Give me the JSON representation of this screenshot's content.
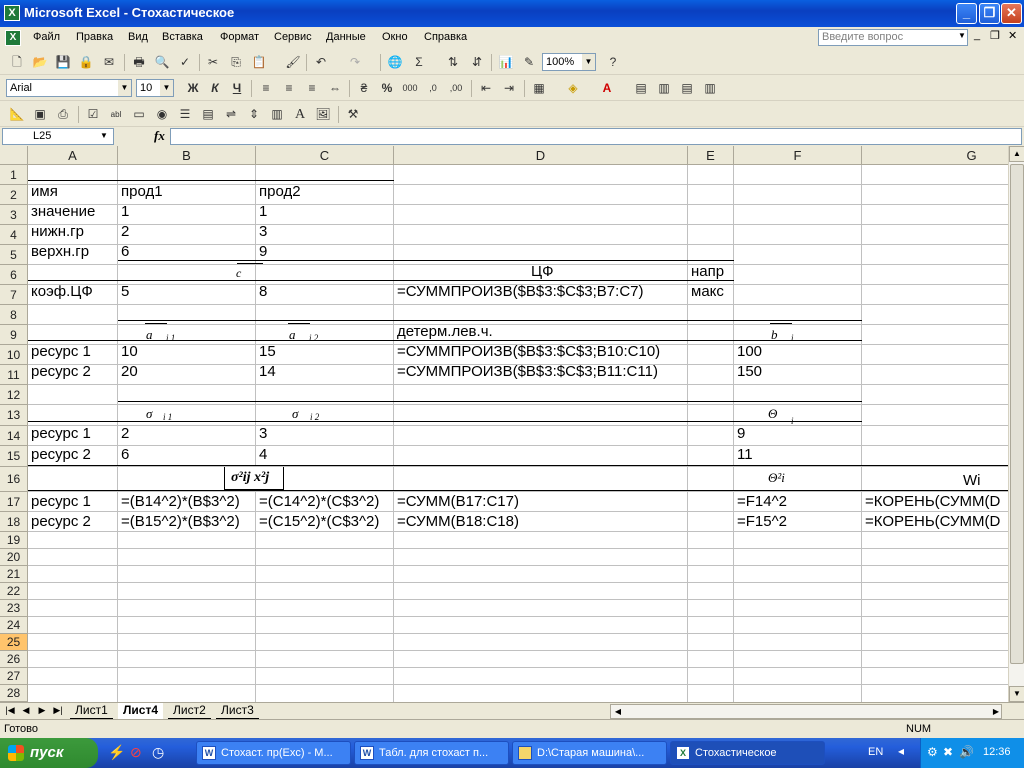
{
  "window": {
    "title": "Microsoft Excel - Стохастическое"
  },
  "menu": [
    "Файл",
    "Правка",
    "Вид",
    "Вставка",
    "Формат",
    "Сервис",
    "Данные",
    "Окно",
    "Справка"
  ],
  "ask_placeholder": "Введите вопрос",
  "toolbar": {
    "zoom": "100%",
    "font": "Arial",
    "size": "10"
  },
  "formula_bar": {
    "name_box": "L25",
    "fx": "fx",
    "formula": ""
  },
  "columns": [
    "A",
    "B",
    "C",
    "D",
    "E",
    "F",
    "G"
  ],
  "rows": [
    "1",
    "2",
    "3",
    "4",
    "5",
    "6",
    "7",
    "8",
    "9",
    "10",
    "11",
    "12",
    "13",
    "14",
    "15",
    "16",
    "17",
    "18",
    "19",
    "20",
    "21",
    "22",
    "23",
    "24",
    "25",
    "26",
    "27",
    "28"
  ],
  "active_row": "25",
  "cells": {
    "A2": "имя",
    "B2": "прод1",
    "C2": "прод2",
    "A3": "значение",
    "B3": "1",
    "C3": "1",
    "A4": "нижн.гр",
    "B4": "2",
    "C4": "3",
    "A5": "верхн.гр",
    "B5": "6",
    "C5": "9",
    "B6": "c",
    "D6": "ЦФ",
    "E6": "напр",
    "A7": "коэф.ЦФ",
    "B7": "5",
    "C7": "8",
    "D7": "=СУММПРОИЗВ($B$3:$C$3;B7:C7)",
    "E7": "макс",
    "B9": "a",
    "B9s": "i 1",
    "C9": "a",
    "C9s": "i 2",
    "D9": "детерм.лев.ч.",
    "F9": "b",
    "F9s": "i",
    "A10": "ресурс 1",
    "B10": "10",
    "C10": "15",
    "D10": "=СУММПРОИЗВ($B$3:$C$3;B10:C10)",
    "F10": "100",
    "A11": "ресурс 2",
    "B11": "20",
    "C11": "14",
    "D11": "=СУММПРОИЗВ($B$3:$C$3;B11:C11)",
    "F11": "150",
    "B13": "σ",
    "B13s": "i 1",
    "C13": "σ",
    "C13s": "i 2",
    "F13": "Θ",
    "F13s": "i",
    "A14": "ресурс 1",
    "B14": "2",
    "C14": "3",
    "F14": "9",
    "A15": "ресурс 2",
    "B15": "6",
    "C15": "4",
    "F15": "11",
    "B16": "σ²ij x²j",
    "F16": "Θ²i",
    "G16": "Wi",
    "A17": "ресурс 1",
    "B17": "=(B14^2)*(B$3^2)",
    "C17": "=(C14^2)*(C$3^2)",
    "D17": "=СУММ(B17:C17)",
    "F17": "=F14^2",
    "G17": "=КОРЕНЬ(СУММ(D",
    "A18": "ресурс 2",
    "B18": "=(B15^2)*(B$3^2)",
    "C18": "=(C15^2)*(C$3^2)",
    "D18": "=СУММ(B18:C18)",
    "F18": "=F15^2",
    "G18": "=КОРЕНЬ(СУММ(D"
  },
  "sheets": [
    "Лист1",
    "Лист4",
    "Лист2",
    "Лист3"
  ],
  "active_sheet": "Лист4",
  "status": {
    "ready": "Готово",
    "num": "NUM"
  },
  "taskbar": {
    "start": "пуск",
    "tasks": [
      "Стохаст. пр(Exc) - M...",
      "Табл. для стохаст п...",
      "D:\\Старая машина\\...",
      "Стохастическое"
    ],
    "lang": "EN",
    "clock": "12:36"
  }
}
